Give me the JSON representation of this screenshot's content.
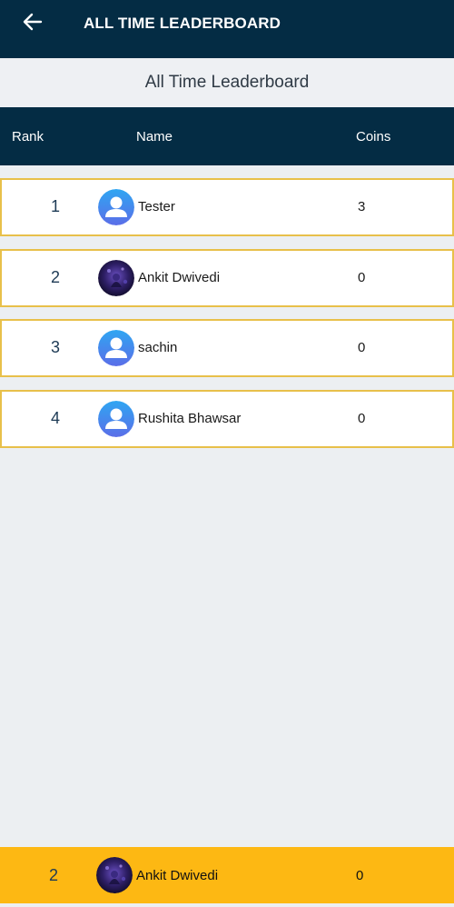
{
  "app_bar": {
    "title": "ALL TIME LEADERBOARD",
    "back_icon": "arrow-left-icon"
  },
  "subheader": {
    "title": "All Time Leaderboard"
  },
  "table": {
    "headers": {
      "rank": "Rank",
      "name": "Name",
      "coins": "Coins"
    },
    "rows": [
      {
        "rank": "1",
        "name": "Tester",
        "coins": "3",
        "avatar": "default-user-icon"
      },
      {
        "rank": "2",
        "name": "Ankit Dwivedi",
        "coins": "0",
        "avatar": "photo-avatar"
      },
      {
        "rank": "3",
        "name": "sachin",
        "coins": "0",
        "avatar": "default-user-icon"
      },
      {
        "rank": "4",
        "name": "Rushita Bhawsar",
        "coins": "0",
        "avatar": "default-user-icon"
      }
    ]
  },
  "current_user": {
    "rank": "2",
    "name": "Ankit Dwivedi",
    "coins": "0",
    "avatar": "photo-avatar"
  },
  "colors": {
    "primary_dark": "#042c44",
    "row_border": "#e8c04a",
    "highlight": "#fdb813",
    "background": "#eceff2"
  }
}
